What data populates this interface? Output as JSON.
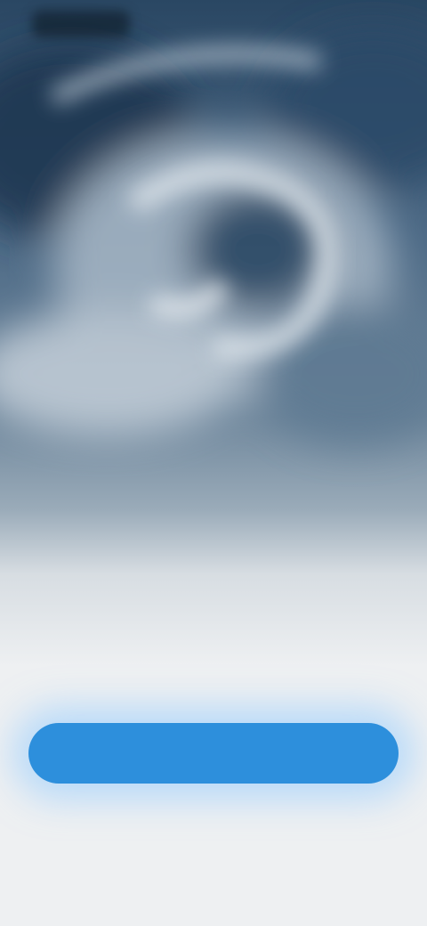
{
  "screen": {
    "headline": "",
    "body": "",
    "primary_button_label": "",
    "footnote": ""
  },
  "colors": {
    "sky_dark": "#1f3a55",
    "sky_mid": "#6a8399",
    "cloud_light": "#c9d3dc",
    "sheet_bg": "#eef0f2",
    "accent_button": "#2d8fdc"
  },
  "icons": []
}
